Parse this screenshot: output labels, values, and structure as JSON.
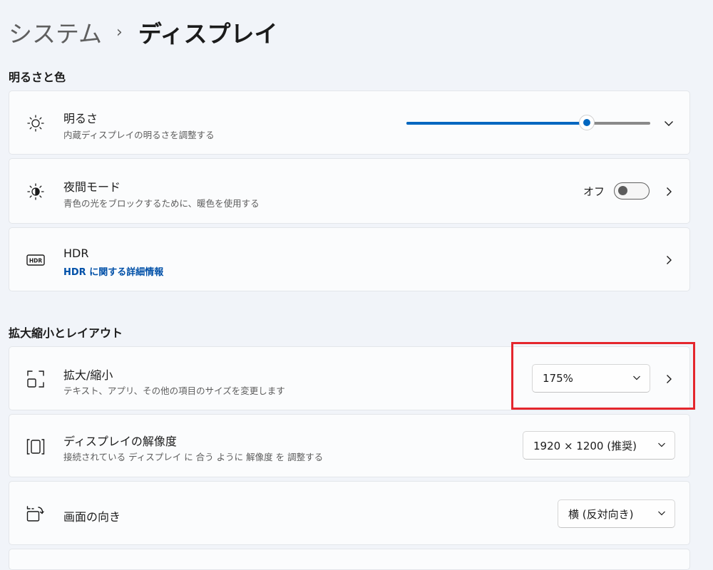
{
  "breadcrumb": {
    "parent": "システム",
    "separator": "›",
    "current": "ディスプレイ"
  },
  "sections": {
    "brightness_color": "明るさと色",
    "scale_layout": "拡大縮小とレイアウト"
  },
  "brightness": {
    "title": "明るさ",
    "subtitle": "内蔵ディスプレイの明るさを調整する",
    "value_percent": 74,
    "icon": "sun-icon"
  },
  "night_light": {
    "title": "夜間モード",
    "subtitle": "青色の光をブロックするために、暖色を使用する",
    "state": "オフ",
    "on": false,
    "icon": "night-light-icon"
  },
  "hdr": {
    "title": "HDR",
    "link": "HDR に関する詳細情報",
    "icon": "hdr-icon"
  },
  "scale": {
    "title": "拡大/縮小",
    "subtitle": "テキスト、アプリ、その他の項目のサイズを変更します",
    "value": "175%",
    "icon": "scale-icon"
  },
  "resolution": {
    "title": "ディスプレイの解像度",
    "subtitle": "接続されている ディスプレイ に 合う ように 解像度 を 調整する",
    "value": "1920 × 1200 (推奨)",
    "icon": "resolution-icon"
  },
  "orientation": {
    "title": "画面の向き",
    "value": "横 (反対向き)",
    "icon": "orientation-icon"
  },
  "colors": {
    "accent": "#0067c0",
    "highlight": "#e4262d",
    "link": "#0050a8"
  }
}
